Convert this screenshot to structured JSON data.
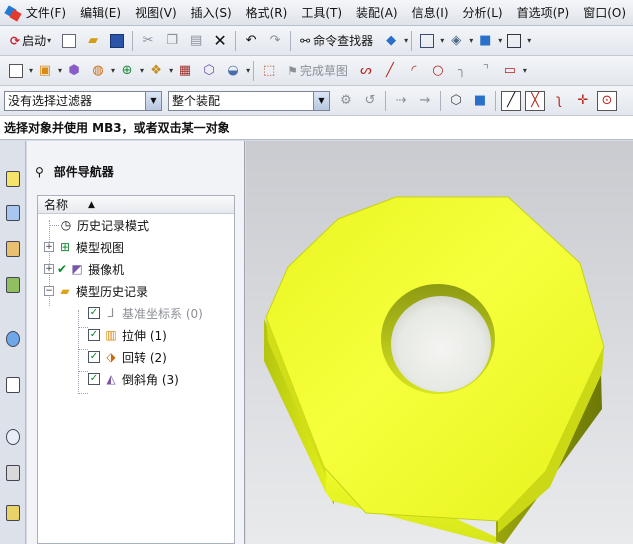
{
  "menu": [
    "文件(F)",
    "编辑(E)",
    "视图(V)",
    "插入(S)",
    "格式(R)",
    "工具(T)",
    "装配(A)",
    "信息(I)",
    "分析(L)",
    "首选项(P)",
    "窗口(O)"
  ],
  "toolbar1": {
    "start_label": "启动",
    "command_finder_label": "命令查找器"
  },
  "toolbar2": {
    "finish_sketch_label": "完成草图"
  },
  "selection": {
    "filter_value": "没有选择过滤器",
    "scope_value": "整个装配"
  },
  "status_message": "选择对象并使用 MB3，或者双击某一对象",
  "navigator": {
    "title": "部件导航器",
    "column_name": "名称",
    "items": [
      {
        "label": "历史记录模式",
        "icon": "clock-icon"
      },
      {
        "label": "模型视图",
        "icon": "model-views-icon"
      },
      {
        "label": "摄像机",
        "icon": "camera-icon"
      },
      {
        "label": "模型历史记录",
        "icon": "folder-icon"
      },
      {
        "label": "基准坐标系 (0)",
        "icon": "datum-csys-icon",
        "checked": true
      },
      {
        "label": "拉伸 (1)",
        "icon": "extrude-icon",
        "checked": true
      },
      {
        "label": "回转 (2)",
        "icon": "revolve-icon",
        "checked": true
      },
      {
        "label": "倒斜角 (3)",
        "icon": "chamfer-icon",
        "checked": true
      }
    ]
  },
  "colors": {
    "model_face": "#f2ff2e",
    "model_side": "#b8c814",
    "model_shadow": "#6f7a0a",
    "checkmark": "#0a8a2a"
  }
}
